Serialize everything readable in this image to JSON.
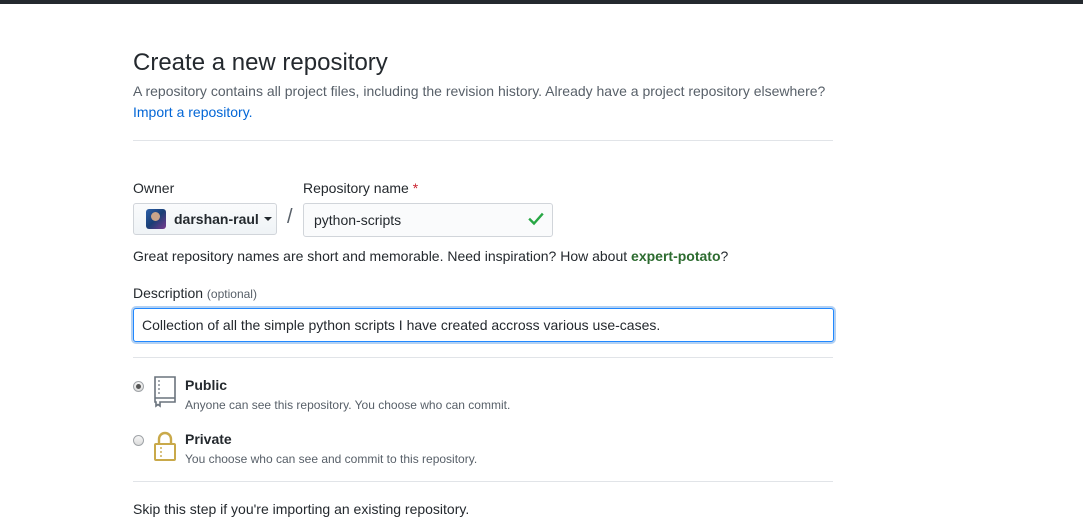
{
  "header": {
    "title": "Create a new repository",
    "subtitle": "A repository contains all project files, including the revision history. Already have a project repository elsewhere?",
    "import_link": "Import a repository."
  },
  "owner": {
    "label": "Owner",
    "value": "darshan-raul"
  },
  "repository_name": {
    "label": "Repository name",
    "required_mark": "*",
    "value": "python-scripts",
    "valid": true
  },
  "separator": "/",
  "name_hint": {
    "text": "Great repository names are short and memorable. Need inspiration? How about ",
    "suggestion": "expert-potato",
    "suffix": "?"
  },
  "description": {
    "label": "Description",
    "optional_label": "(optional)",
    "value": "Collection of all the simple python scripts I have created accross various use-cases."
  },
  "visibility": {
    "options": [
      {
        "title": "Public",
        "note": "Anyone can see this repository. You choose who can commit.",
        "selected": true,
        "icon": "repo-book-icon"
      },
      {
        "title": "Private",
        "note": "You choose who can see and commit to this repository.",
        "selected": false,
        "icon": "lock-icon"
      }
    ]
  },
  "skip_note": "Skip this step if you're importing an existing repository.",
  "colors": {
    "link": "#0366d6",
    "valid_check": "#28a745",
    "suggestion": "#2c6b2f",
    "required": "#cb2431",
    "focus_border": "#2188ff"
  }
}
